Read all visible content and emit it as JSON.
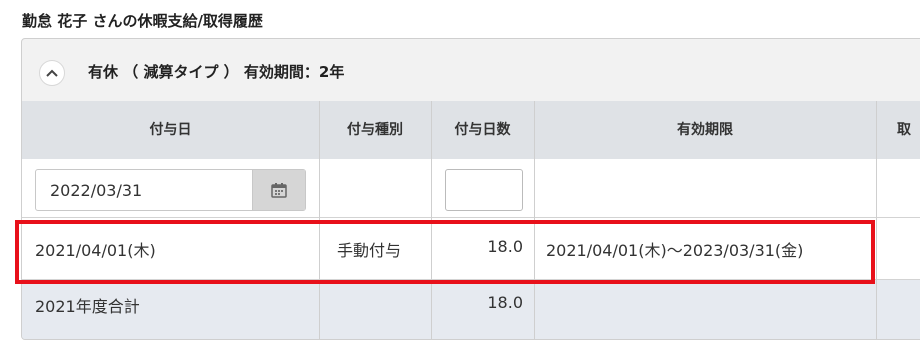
{
  "page": {
    "title": "勤怠 花子 さんの休暇支給/取得履歴"
  },
  "panel": {
    "title": "有休 （ 減算タイプ ） 有効期間：2年"
  },
  "table": {
    "headers": [
      "付与日",
      "付与種別",
      "付与日数",
      "有効期限",
      "取"
    ],
    "input_row": {
      "date_value": "2022/03/31",
      "days_value": ""
    },
    "data_row": {
      "grant_date": "2021/04/01(木)",
      "grant_type": "手動付与",
      "grant_days": "18.0",
      "expiry": "2021/04/01(木)～2023/03/31(金)"
    },
    "total_row": {
      "label": "2021年度合計",
      "grant_days": "18.0"
    }
  },
  "colors": {
    "highlight": "#e8101a",
    "header_bg": "#dfe2e6",
    "total_bg": "#e6eaf0"
  },
  "icons": {
    "collapse": "chevron-up-icon",
    "calendar": "calendar-icon"
  }
}
